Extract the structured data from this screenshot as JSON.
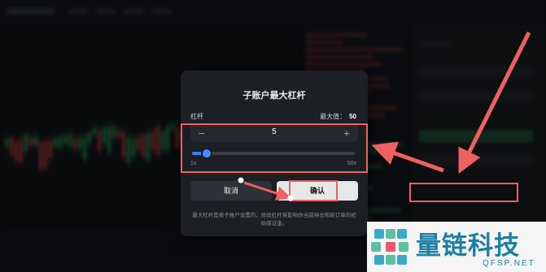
{
  "modal": {
    "title": "子账户最大杠杆",
    "leverage_label": "杠杆",
    "max_label": "最大值：",
    "max_value": "50",
    "stepper": {
      "minus": "−",
      "value": "5",
      "plus": "+"
    },
    "slider": {
      "min_label": "1x",
      "max_label": "50x",
      "level_fraction": 0.09
    },
    "cancel_label": "取消",
    "confirm_label": "确认",
    "footnote": "最大杠杆是按子账户设置的，修改杠杆将影响你当前持仓和新订单的初始保证金。"
  },
  "colors": {
    "accent_red": "#f0605f",
    "slider_blue": "#3d7cf5",
    "watermark_blue": "#1e7fa5"
  },
  "watermark": {
    "text": "量链科技",
    "sub": "QFSP.NET"
  }
}
